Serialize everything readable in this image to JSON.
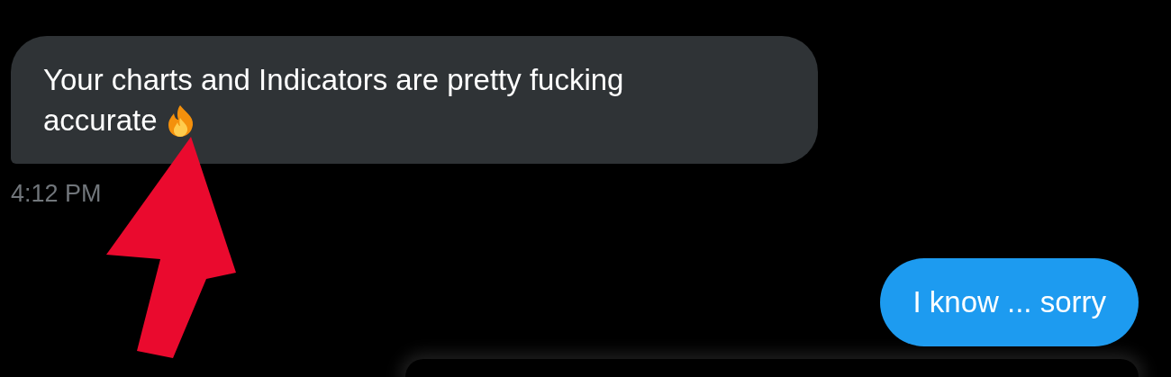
{
  "messages": [
    {
      "kind": "received",
      "text": "Your charts and Indicators are pretty fucking accurate",
      "trailing_icon": true,
      "time": "4:12 PM"
    },
    {
      "kind": "sent",
      "text": "I know ... sorry"
    }
  ]
}
